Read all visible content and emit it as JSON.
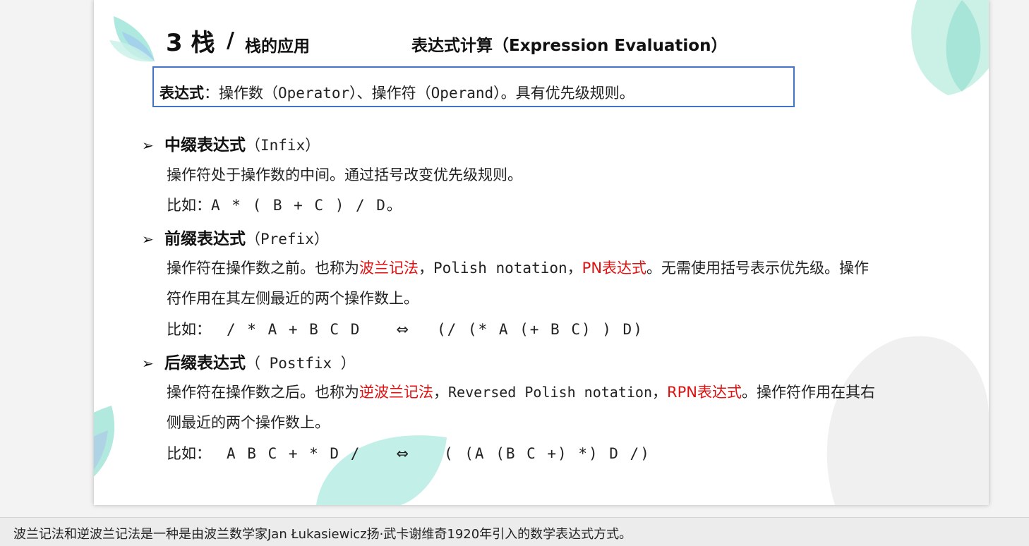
{
  "slide": {
    "title_num": "3 栈",
    "title_slash": "/",
    "title_sub": "栈的应用",
    "title_right": "表达式计算（Expression Evaluation）",
    "definition": {
      "term": "表达式",
      "text_a": "：操作数（",
      "operator": "Operator",
      "text_b": "）、操作符（",
      "operand": "Operand",
      "text_c": "）。具有优先级规则。"
    },
    "infix": {
      "head": "中缀表达式",
      "paren": "（Infix）",
      "desc": "操作符处于操作数的中间。通过括号改变优先级规则。",
      "example_label": "比如：",
      "example": "A * ( B + C ) / D。"
    },
    "prefix": {
      "head": "前缀表达式",
      "paren": "（Prefix）",
      "desc_a": "操作符在操作数之前。也称为",
      "desc_red1": "波兰记法",
      "desc_b": "，",
      "desc_mono": "Polish notation",
      "desc_c": "，",
      "desc_red2": "PN表达式",
      "desc_d": "。无需使用括号表示优先级。操作",
      "desc_line2": "符作用在其左侧最近的两个操作数上。",
      "example_label": "比如：",
      "example_left": "/ * A + B C D",
      "equiv": "⇔",
      "example_right": "(/ (* A (+ B C) ) D)"
    },
    "postfix": {
      "head": "后缀表达式",
      "paren": "（ Postfix ）",
      "desc_a": "操作符在操作数之后。也称为",
      "desc_red1": "逆波兰记法",
      "desc_b": "，",
      "desc_mono": "Reversed Polish notation",
      "desc_c": "，",
      "desc_red2": "RPN表达式",
      "desc_d": "。操作符作用在其右",
      "desc_line2": "侧最近的两个操作数上。",
      "example_label": "比如：",
      "example_left": "A B C + * D /",
      "equiv": "⇔",
      "example_right": "( (A (B C +) *) D /)"
    },
    "bullet_glyph": "➢"
  },
  "footer": {
    "note": "波兰记法和逆波兰记法是一种是由波兰数学家Jan Łukasiewicz扬·武卡谢维奇1920年引入的数学表达式方式。"
  },
  "colors": {
    "accent_border": "#4472c4",
    "highlight_red": "#e01010",
    "leaf_teal": "#7fdccb"
  }
}
